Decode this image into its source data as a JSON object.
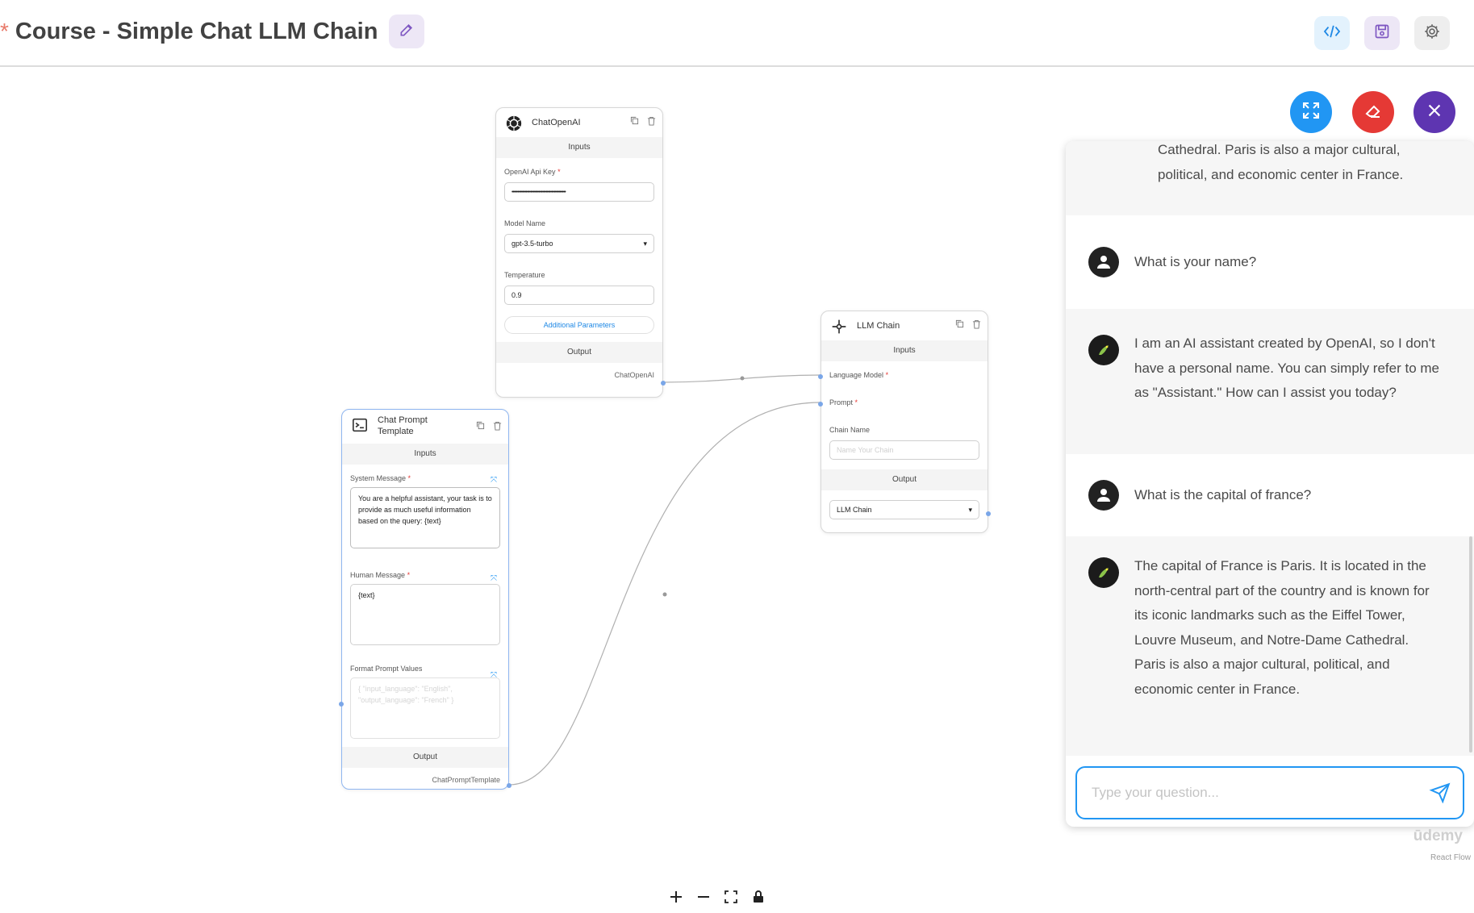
{
  "header": {
    "unsaved_marker": "*",
    "title": "Course - Simple Chat LLM Chain"
  },
  "nodes": {
    "chat_openai": {
      "title": "ChatOpenAI",
      "inputs_label": "Inputs",
      "api_key_label": "OpenAI Api Key",
      "api_key_value": "••••••••••••••••••••••••••••••••••••••••••••••",
      "model_label": "Model Name",
      "model_value": "gpt-3.5-turbo",
      "temperature_label": "Temperature",
      "temperature_value": "0.9",
      "additional_params": "Additional Parameters",
      "output_label": "Output",
      "output_handle": "ChatOpenAI"
    },
    "llm_chain": {
      "title": "LLM Chain",
      "inputs_label": "Inputs",
      "language_model_label": "Language Model",
      "prompt_label": "Prompt",
      "chain_name_label": "Chain Name",
      "chain_name_placeholder": "Name Your Chain",
      "output_label": "Output",
      "output_value": "LLM Chain"
    },
    "chat_prompt": {
      "title": "Chat Prompt Template",
      "inputs_label": "Inputs",
      "system_label": "System Message",
      "system_value": "You are a helpful assistant, your task is to provide as much useful information based on the query: {text}",
      "human_label": "Human Message",
      "human_value": "{text}",
      "format_label": "Format Prompt Values",
      "format_placeholder": "{ \"input_language\": \"English\", \"output_language\": \"French\" }",
      "output_label": "Output",
      "output_handle": "ChatPromptTemplate"
    }
  },
  "chat": {
    "messages": [
      {
        "role": "api",
        "text": "Cathedral. Paris is also a major cultural, political, and economic center in France."
      },
      {
        "role": "user",
        "text": "What is your name?"
      },
      {
        "role": "api",
        "text": "I am an AI assistant created by OpenAI, so I don't have a personal name. You can simply refer to me as \"Assistant.\" How can I assist you today?"
      },
      {
        "role": "user",
        "text": "What is the capital of france?"
      },
      {
        "role": "api",
        "text": "The capital of France is Paris. It is located in the north-central part of the country and is known for its iconic landmarks such as the Eiffel Tower, Louvre Museum, and Notre-Dame Cathedral. Paris is also a major cultural, political, and economic center in France."
      }
    ],
    "input_placeholder": "Type your question..."
  },
  "watermark": "ūdemy",
  "attribution": "React Flow",
  "colors": {
    "expand_fab": "#2196f3",
    "clear_fab": "#e53935",
    "close_fab": "#5e35b1",
    "accent": "#2196f3"
  }
}
